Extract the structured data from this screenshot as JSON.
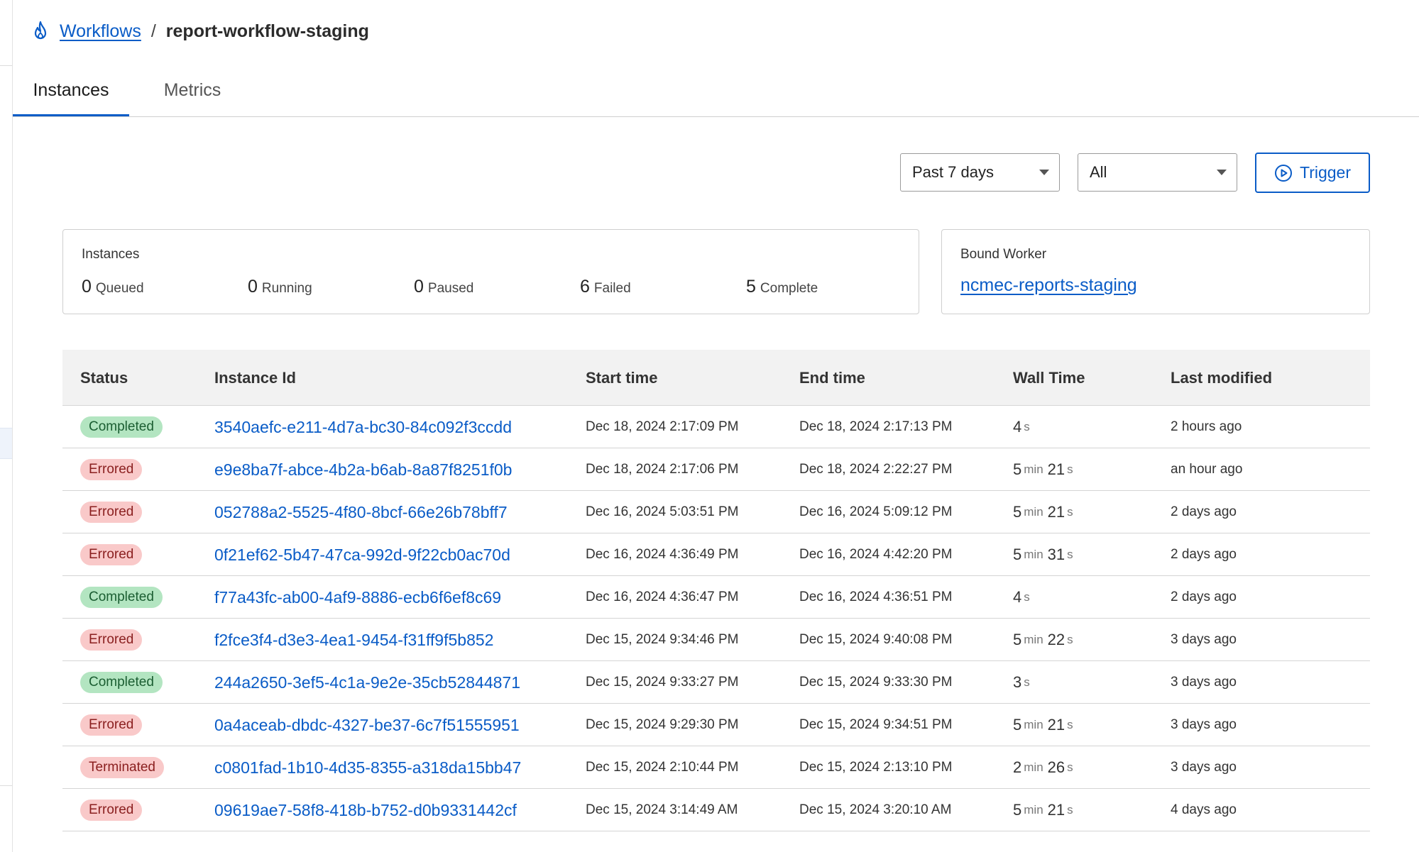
{
  "breadcrumb": {
    "root": "Workflows",
    "separator": "/",
    "current": "report-workflow-staging"
  },
  "tabs": [
    {
      "label": "Instances",
      "active": true
    },
    {
      "label": "Metrics",
      "active": false
    }
  ],
  "filters": {
    "range": "Past 7 days",
    "status": "All"
  },
  "trigger_label": "Trigger",
  "summary": {
    "title": "Instances",
    "stats": [
      {
        "count": "0",
        "label": "Queued"
      },
      {
        "count": "0",
        "label": "Running"
      },
      {
        "count": "0",
        "label": "Paused"
      },
      {
        "count": "6",
        "label": "Failed"
      },
      {
        "count": "5",
        "label": "Complete"
      }
    ]
  },
  "worker": {
    "title": "Bound Worker",
    "name": "ncmec-reports-staging"
  },
  "table": {
    "headers": [
      "Status",
      "Instance Id",
      "Start time",
      "End time",
      "Wall Time",
      "Last modified"
    ],
    "rows": [
      {
        "status": "Completed",
        "kind": "completed",
        "id": "3540aefc-e211-4d7a-bc30-84c092f3ccdd",
        "start": "Dec 18, 2024 2:17:09 PM",
        "end": "Dec 18, 2024 2:17:13 PM",
        "wall": [
          [
            "4",
            "s"
          ]
        ],
        "modified": "2 hours ago"
      },
      {
        "status": "Errored",
        "kind": "errored",
        "id": "e9e8ba7f-abce-4b2a-b6ab-8a87f8251f0b",
        "start": "Dec 18, 2024 2:17:06 PM",
        "end": "Dec 18, 2024 2:22:27 PM",
        "wall": [
          [
            "5",
            "min"
          ],
          [
            "21",
            "s"
          ]
        ],
        "modified": "an hour ago"
      },
      {
        "status": "Errored",
        "kind": "errored",
        "id": "052788a2-5525-4f80-8bcf-66e26b78bff7",
        "start": "Dec 16, 2024 5:03:51 PM",
        "end": "Dec 16, 2024 5:09:12 PM",
        "wall": [
          [
            "5",
            "min"
          ],
          [
            "21",
            "s"
          ]
        ],
        "modified": "2 days ago"
      },
      {
        "status": "Errored",
        "kind": "errored",
        "id": "0f21ef62-5b47-47ca-992d-9f22cb0ac70d",
        "start": "Dec 16, 2024 4:36:49 PM",
        "end": "Dec 16, 2024 4:42:20 PM",
        "wall": [
          [
            "5",
            "min"
          ],
          [
            "31",
            "s"
          ]
        ],
        "modified": "2 days ago"
      },
      {
        "status": "Completed",
        "kind": "completed",
        "id": "f77a43fc-ab00-4af9-8886-ecb6f6ef8c69",
        "start": "Dec 16, 2024 4:36:47 PM",
        "end": "Dec 16, 2024 4:36:51 PM",
        "wall": [
          [
            "4",
            "s"
          ]
        ],
        "modified": "2 days ago"
      },
      {
        "status": "Errored",
        "kind": "errored",
        "id": "f2fce3f4-d3e3-4ea1-9454-f31ff9f5b852",
        "start": "Dec 15, 2024 9:34:46 PM",
        "end": "Dec 15, 2024 9:40:08 PM",
        "wall": [
          [
            "5",
            "min"
          ],
          [
            "22",
            "s"
          ]
        ],
        "modified": "3 days ago"
      },
      {
        "status": "Completed",
        "kind": "completed",
        "id": "244a2650-3ef5-4c1a-9e2e-35cb52844871",
        "start": "Dec 15, 2024 9:33:27 PM",
        "end": "Dec 15, 2024 9:33:30 PM",
        "wall": [
          [
            "3",
            "s"
          ]
        ],
        "modified": "3 days ago"
      },
      {
        "status": "Errored",
        "kind": "errored",
        "id": "0a4aceab-dbdc-4327-be37-6c7f51555951",
        "start": "Dec 15, 2024 9:29:30 PM",
        "end": "Dec 15, 2024 9:34:51 PM",
        "wall": [
          [
            "5",
            "min"
          ],
          [
            "21",
            "s"
          ]
        ],
        "modified": "3 days ago"
      },
      {
        "status": "Terminated",
        "kind": "terminated",
        "id": "c0801fad-1b10-4d35-8355-a318da15bb47",
        "start": "Dec 15, 2024 2:10:44 PM",
        "end": "Dec 15, 2024 2:13:10 PM",
        "wall": [
          [
            "2",
            "min"
          ],
          [
            "26",
            "s"
          ]
        ],
        "modified": "3 days ago"
      },
      {
        "status": "Errored",
        "kind": "errored",
        "id": "09619ae7-58f8-418b-b752-d0b9331442cf",
        "start": "Dec 15, 2024 3:14:49 AM",
        "end": "Dec 15, 2024 3:20:10 AM",
        "wall": [
          [
            "5",
            "min"
          ],
          [
            "21",
            "s"
          ]
        ],
        "modified": "4 days ago"
      }
    ]
  }
}
